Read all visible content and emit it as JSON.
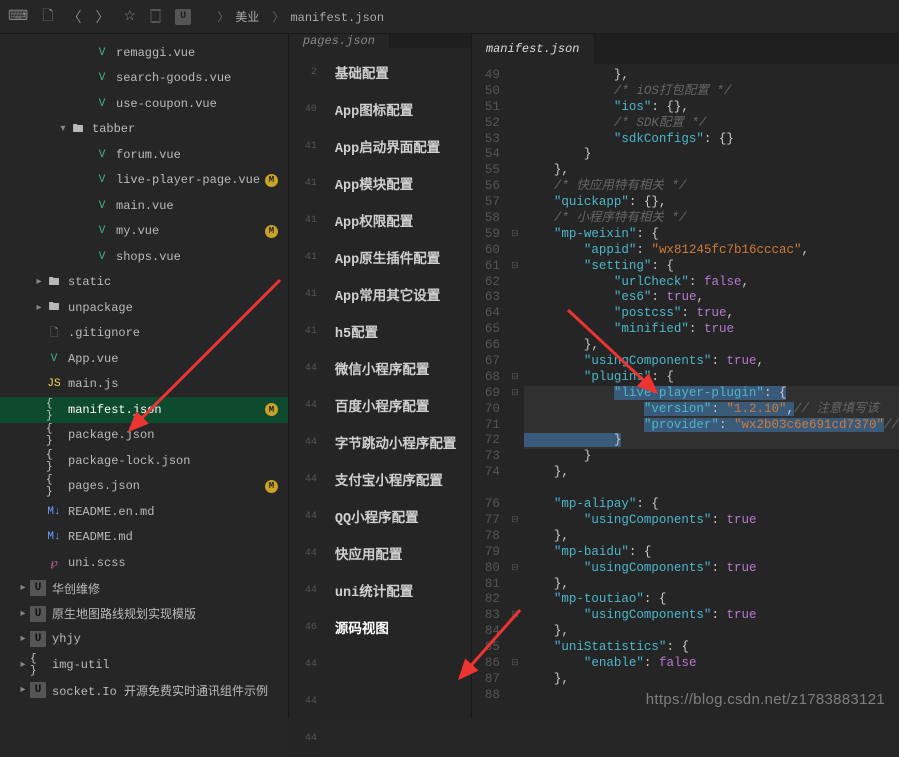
{
  "breadcrumb": {
    "root": "美业",
    "file": "manifest.json"
  },
  "sidebar": {
    "items": [
      {
        "label": "remaggi.vue",
        "icon": "vue",
        "pad": 4
      },
      {
        "label": "search-goods.vue",
        "icon": "vue",
        "pad": 4
      },
      {
        "label": "use-coupon.vue",
        "icon": "vue",
        "pad": 4
      },
      {
        "label": "tabber",
        "icon": "fold",
        "pad": 3,
        "chev": "v"
      },
      {
        "label": "forum.vue",
        "icon": "vue",
        "pad": 4
      },
      {
        "label": "live-player-page.vue",
        "icon": "vue",
        "pad": 4,
        "badge": "M"
      },
      {
        "label": "main.vue",
        "icon": "vue",
        "pad": 4
      },
      {
        "label": "my.vue",
        "icon": "vue",
        "pad": 4,
        "badge": "M"
      },
      {
        "label": "shops.vue",
        "icon": "vue",
        "pad": 4
      },
      {
        "label": "static",
        "icon": "fold",
        "pad": 2,
        "chev": ">"
      },
      {
        "label": "unpackage",
        "icon": "fold",
        "pad": 2,
        "chev": ">"
      },
      {
        "label": ".gitignore",
        "icon": "txt",
        "pad": 2
      },
      {
        "label": "App.vue",
        "icon": "vue",
        "pad": 2
      },
      {
        "label": "main.js",
        "icon": "js",
        "pad": 2
      },
      {
        "label": "manifest.json",
        "icon": "json",
        "pad": 2,
        "badge": "M",
        "active": true
      },
      {
        "label": "package.json",
        "icon": "json",
        "pad": 2
      },
      {
        "label": "package-lock.json",
        "icon": "json",
        "pad": 2
      },
      {
        "label": "pages.json",
        "icon": "json",
        "pad": 2,
        "badge": "M"
      },
      {
        "label": "README.en.md",
        "icon": "md",
        "pad": 2
      },
      {
        "label": "README.md",
        "icon": "md",
        "pad": 2
      },
      {
        "label": "uni.scss",
        "icon": "scss",
        "pad": 2
      },
      {
        "label": "华创维修",
        "icon": "u",
        "pad": 1,
        "chev": ">"
      },
      {
        "label": "原生地图路线规划实现模版",
        "icon": "u",
        "pad": 1,
        "chev": ">"
      },
      {
        "label": "yhjy",
        "icon": "u",
        "pad": 1,
        "chev": ">"
      },
      {
        "label": "img-util",
        "icon": "json",
        "pad": 1,
        "chev": ">"
      },
      {
        "label": "socket.Io 开源免费实时通讯组件示例",
        "icon": "u",
        "pad": 1,
        "chev": ">"
      }
    ]
  },
  "centerTab": "pages.json",
  "centerGutter": [
    "2",
    "40",
    "41",
    "41",
    "41",
    "41",
    "41",
    "41",
    "44",
    "44",
    "44",
    "44",
    "44",
    "44",
    "44",
    "46",
    "44",
    "44",
    "44"
  ],
  "nav": {
    "items": [
      "基础配置",
      "App图标配置",
      "App启动界面配置",
      "App模块配置",
      "App权限配置",
      "App原生插件配置",
      "App常用其它设置",
      "h5配置",
      "微信小程序配置",
      "百度小程序配置",
      "字节跳动小程序配置",
      "支付宝小程序配置",
      "QQ小程序配置",
      "快应用配置",
      "uni统计配置",
      "源码视图"
    ],
    "activeIndex": 15
  },
  "editorTab": "manifest.json",
  "lineNumbers": [
    "49",
    "50",
    "51",
    "52",
    "53",
    "54",
    "55",
    "56",
    "57",
    "58",
    "59",
    "60",
    "61",
    "62",
    "63",
    "64",
    "65",
    "66",
    "67",
    "68",
    "69",
    "70",
    "71",
    "72",
    "73",
    "74",
    "",
    "76",
    "77",
    "78",
    "79",
    "80",
    "81",
    "82",
    "83",
    "84",
    "85",
    "86",
    "87",
    "88"
  ],
  "foldMarks": {
    "10": "⊟",
    "12": "⊟",
    "19": "⊟",
    "20": "⊟",
    "28": "⊟",
    "31": "⊟",
    "34": "⊟",
    "37": "⊟"
  },
  "code": {
    "l49": "            },",
    "l50a": "            ",
    "l50c": "/* iOS打包配置 */",
    "l51a": "            ",
    "l51k": "\"ios\"",
    "l51b": ": {},",
    "l52a": "            ",
    "l52c": "/* SDK配置 */",
    "l53a": "            ",
    "l53k": "\"sdkConfigs\"",
    "l53b": ": {}",
    "l54": "        }",
    "l55": "    },",
    "l56a": "    ",
    "l56c": "/* 快应用特有相关 */",
    "l57a": "    ",
    "l57k": "\"quickapp\"",
    "l57b": ": {},",
    "l58a": "    ",
    "l58c": "/* 小程序特有相关 */",
    "l59a": "    ",
    "l59k": "\"mp-weixin\"",
    "l59b": ": {",
    "l60a": "        ",
    "l60k": "\"appid\"",
    "l60b": ": ",
    "l60s": "\"wx81245fc7b16cccac\"",
    "l60e": ",",
    "l61a": "        ",
    "l61k": "\"setting\"",
    "l61b": ": {",
    "l62a": "            ",
    "l62k": "\"urlCheck\"",
    "l62b": ": ",
    "l62v": "false",
    "l62e": ",",
    "l63a": "            ",
    "l63k": "\"es6\"",
    "l63b": ": ",
    "l63v": "true",
    "l63e": ",",
    "l64a": "            ",
    "l64k": "\"postcss\"",
    "l64b": ": ",
    "l64v": "true",
    "l64e": ",",
    "l65a": "            ",
    "l65k": "\"minified\"",
    "l65b": ": ",
    "l65v": "true",
    "l66": "        },",
    "l67a": "        ",
    "l67k": "\"usingComponents\"",
    "l67b": ": ",
    "l67v": "true",
    "l67e": ",",
    "l68a": "        ",
    "l68k": "\"plugins\"",
    "l68b": ": {",
    "l69a": "            ",
    "l69k": "\"live-player-plugin\"",
    "l69b": ": {",
    "l70a": "                ",
    "l70k": "\"version\"",
    "l70b": ": ",
    "l70s": "\"1.2.10\"",
    "l70e": ",",
    "l70c": "// 注意填写该",
    "l71a": "                ",
    "l71k": "\"provider\"",
    "l71b": ": ",
    "l71s": "\"wx2b03c6e691cd7370\"",
    "l71e": "//",
    "l72": "            }",
    "l73": "        }",
    "l74": "    },",
    "l76a": "    ",
    "l76k": "\"mp-alipay\"",
    "l76b": ": {",
    "l77a": "        ",
    "l77k": "\"usingComponents\"",
    "l77b": ": ",
    "l77v": "true",
    "l78": "    },",
    "l79a": "    ",
    "l79k": "\"mp-baidu\"",
    "l79b": ": {",
    "l80a": "        ",
    "l80k": "\"usingComponents\"",
    "l80b": ": ",
    "l80v": "true",
    "l81": "    },",
    "l82a": "    ",
    "l82k": "\"mp-toutiao\"",
    "l82b": ": {",
    "l83a": "        ",
    "l83k": "\"usingComponents\"",
    "l83b": ": ",
    "l83v": "true",
    "l84": "    },",
    "l85a": "    ",
    "l85k": "\"uniStatistics\"",
    "l85b": ": {",
    "l86a": "        ",
    "l86k": "\"enable\"",
    "l86b": ": ",
    "l86v": "false",
    "l87": "    },",
    "l88": ""
  },
  "watermark": "https://blog.csdn.net/z1783883121"
}
